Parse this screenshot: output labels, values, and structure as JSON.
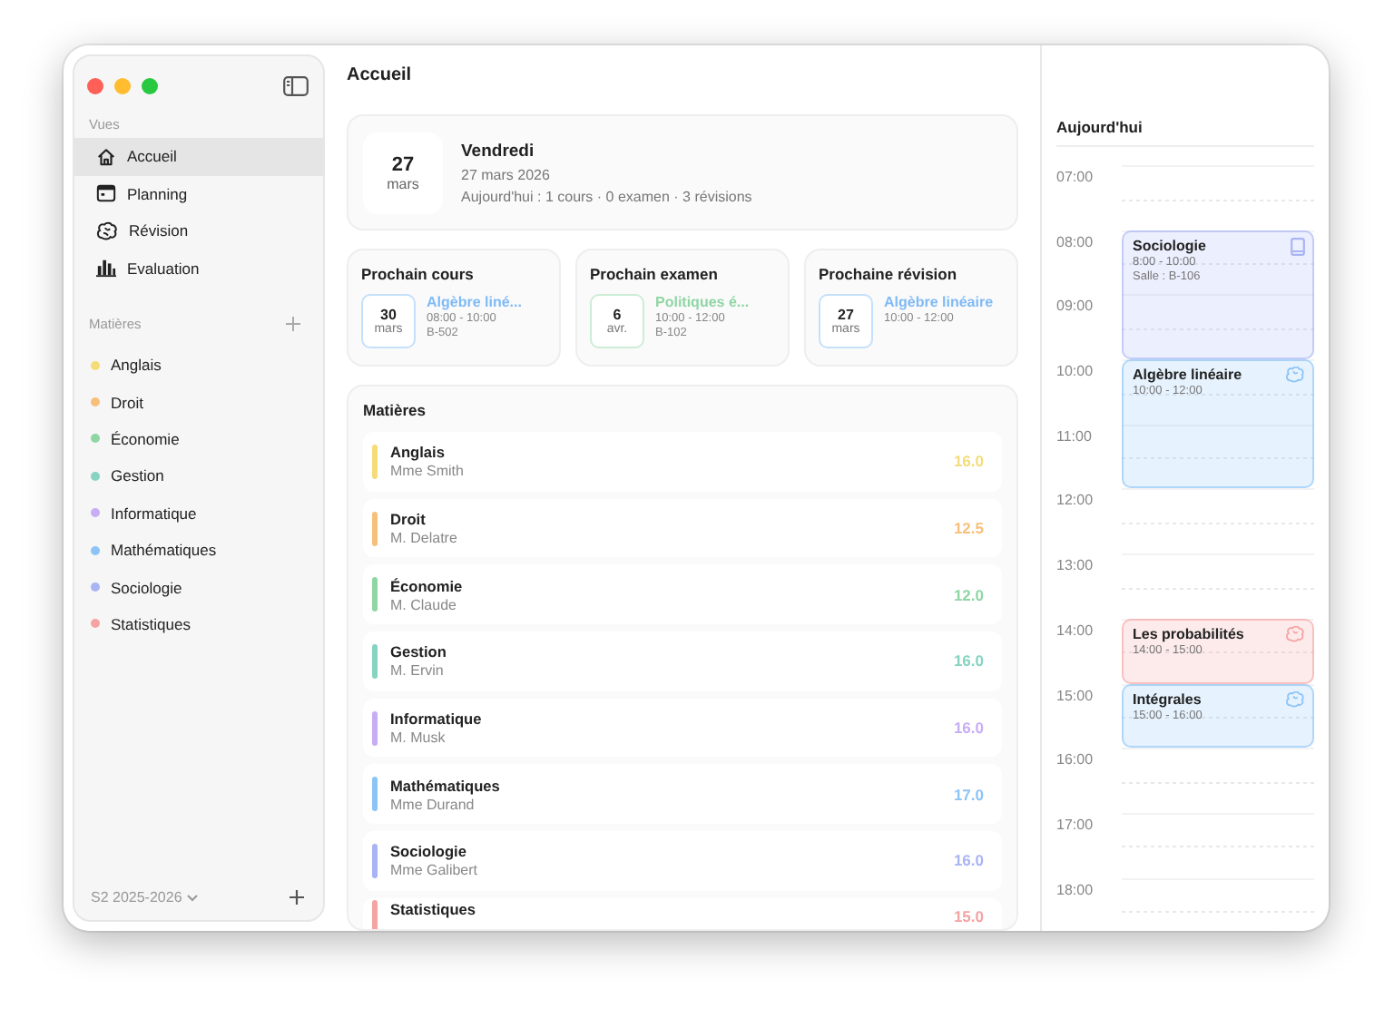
{
  "window": {
    "title": "Accueil"
  },
  "sidebar": {
    "views_heading": "Vues",
    "items": [
      {
        "label": "Accueil",
        "selected": true
      },
      {
        "label": "Planning",
        "selected": false
      },
      {
        "label": "Révision",
        "selected": false
      },
      {
        "label": "Evaluation",
        "selected": false
      }
    ],
    "subjects_heading": "Matières",
    "subjects": [
      {
        "label": "Anglais",
        "color": "#f5dc78"
      },
      {
        "label": "Droit",
        "color": "#f7c07a"
      },
      {
        "label": "Économie",
        "color": "#8fd6a4"
      },
      {
        "label": "Gestion",
        "color": "#86d3c1"
      },
      {
        "label": "Informatique",
        "color": "#c7adf3"
      },
      {
        "label": "Mathématiques",
        "color": "#8cc4f7"
      },
      {
        "label": "Sociologie",
        "color": "#a9b4f5"
      },
      {
        "label": "Statistiques",
        "color": "#f5a3a3"
      }
    ],
    "semester": "S2 2025-2026"
  },
  "today_card": {
    "day": "27",
    "month": "mars",
    "weekday": "Vendredi",
    "date": "27 mars 2026",
    "summary": "Aujourd'hui : 1 cours · 0 examen · 3 révisions"
  },
  "upcoming": [
    {
      "heading": "Prochain cours",
      "day": "30",
      "month": "mars",
      "title": "Algèbre liné...",
      "color": "#7fbaf5",
      "lines": [
        "08:00 - 10:00",
        "B-502"
      ]
    },
    {
      "heading": "Prochain examen",
      "day": "6",
      "month": "avr.",
      "title": "Politiques é...",
      "color": "#8fd6a4",
      "lines": [
        "10:00 - 12:00",
        "B-102"
      ]
    },
    {
      "heading": "Prochaine révision",
      "day": "27",
      "month": "mars",
      "title": "Algèbre linéaire",
      "color": "#7fbaf5",
      "lines": [
        "10:00 - 12:00"
      ]
    }
  ],
  "subjects_card": {
    "heading": "Matières",
    "rows": [
      {
        "name": "Anglais",
        "teacher": "Mme Smith",
        "grade": "16.0",
        "color": "#f5dc78"
      },
      {
        "name": "Droit",
        "teacher": "M. Delatre",
        "grade": "12.5",
        "color": "#f7c07a"
      },
      {
        "name": "Économie",
        "teacher": "M. Claude",
        "grade": "12.0",
        "color": "#8fd6a4"
      },
      {
        "name": "Gestion",
        "teacher": "M. Ervin",
        "grade": "16.0",
        "color": "#86d3c1"
      },
      {
        "name": "Informatique",
        "teacher": "M. Musk",
        "grade": "16.0",
        "color": "#c7adf3"
      },
      {
        "name": "Mathématiques",
        "teacher": "Mme Durand",
        "grade": "17.0",
        "color": "#8cc4f7"
      },
      {
        "name": "Sociologie",
        "teacher": "Mme Galibert",
        "grade": "16.0",
        "color": "#a9b4f5"
      },
      {
        "name": "Statistiques",
        "grade": "15.0",
        "color": "#f5a3a3"
      }
    ]
  },
  "agenda": {
    "heading": "Aujourd'hui",
    "hours": [
      "07:00",
      "08:00",
      "09:00",
      "10:00",
      "11:00",
      "12:00",
      "13:00",
      "14:00",
      "15:00",
      "16:00",
      "17:00",
      "18:00"
    ],
    "events": [
      {
        "title": "Sociologie",
        "time": "8:00 - 10:00",
        "room": "Salle : B-106",
        "kind": "course",
        "color": "#a9b4f5"
      },
      {
        "title": "Algèbre linéaire",
        "time": "10:00 - 12:00",
        "kind": "revision",
        "color": "#8cc4f7"
      },
      {
        "title": "Les probabilités",
        "time": "14:00 - 15:00",
        "kind": "revision",
        "color": "#f5a3a3"
      },
      {
        "title": "Intégrales",
        "time": "15:00 - 16:00",
        "kind": "revision",
        "color": "#8cc4f7"
      }
    ]
  }
}
